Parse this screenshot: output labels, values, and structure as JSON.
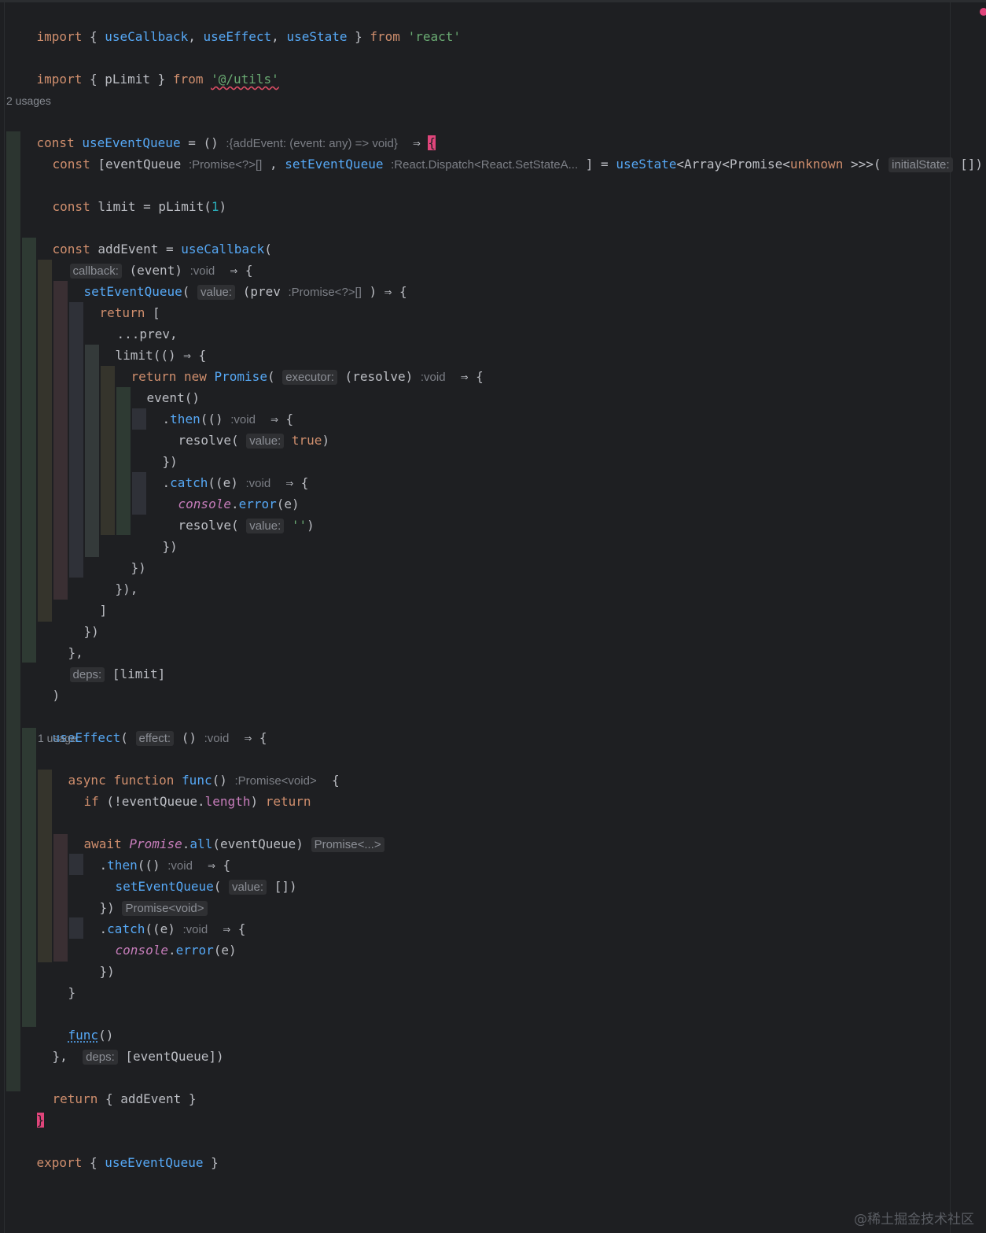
{
  "editor": {
    "usage_counts": {
      "use_event_queue": "2 usages",
      "func": "1 usage"
    },
    "watermark": "@稀土掘金技术社区",
    "colors": {
      "background": "#1e1f22",
      "keyword": "#cf8e6d",
      "function": "#56a8f5",
      "string": "#6aab73",
      "number": "#2aacb8",
      "italic_builtin": "#c77dbb",
      "error_marker": "#e0457b"
    }
  },
  "code": {
    "l1": {
      "kw_import": "import",
      "p1": " { ",
      "f1": "useCallback",
      "p2": ", ",
      "f2": "useEffect",
      "p3": ", ",
      "f3": "useState",
      "p4": " } ",
      "kw_from": "from",
      "sp": " ",
      "str": "'react'"
    },
    "l2": {
      "kw_import": "import",
      "p1": " { pLimit } ",
      "kw_from": "from",
      "sp": " ",
      "str": "'@/utils'"
    },
    "l3": {
      "kw": "const",
      "sp": " ",
      "fn": "useEventQueue",
      "p1": " = () ",
      "hint": ":{addEvent: (event: any) => void}",
      "p2": "  ⇒ ",
      "brace": "{"
    },
    "l4": {
      "kw": "const",
      "p1": " [eventQueue ",
      "h1": ":Promise<?>[]",
      "p2": " , ",
      "fn1": "setEventQueue",
      "sp": " ",
      "h2": ":React.Dispatch<React.SetStateA...",
      "p3": " ] = ",
      "fn2": "useState",
      "p4": "<Array<Promise<",
      "kw2": "unknown",
      "p5": " >>>( ",
      "ph": "initialState:",
      "p6": " [])"
    },
    "l5": {
      "kw": "const",
      "p1": " limit = pLimit(",
      "num": "1",
      "p2": ")"
    },
    "l6": {
      "kw": "const",
      "p1": " addEvent = ",
      "fn": "useCallback",
      "p2": "("
    },
    "l7": {
      "ph": "callback:",
      "p1": " (event) ",
      "h": ":void",
      "p2": "  ⇒ {"
    },
    "l8": {
      "fn": "setEventQueue",
      "p1": "( ",
      "ph": "value:",
      "p2": " (prev ",
      "h": ":Promise<?>[]",
      "p3": " ) ⇒ {"
    },
    "l9": {
      "kw": "return",
      "p1": " ["
    },
    "l10": {
      "p1": "...prev,"
    },
    "l11": {
      "p1": "limit(() ⇒ {"
    },
    "l12": {
      "kw1": "return",
      "sp": " ",
      "kw2": "new",
      "sp2": " ",
      "fn": "Promise",
      "p1": "( ",
      "ph": "executor:",
      "p2": " (resolve) ",
      "h": ":void",
      "p3": "  ⇒ {"
    },
    "l13": {
      "p1": "event()"
    },
    "l14": {
      "p1": ".",
      "fn": "then",
      "p2": "(() ",
      "h": ":void",
      "p3": "  ⇒ {"
    },
    "l15": {
      "p1": "resolve( ",
      "ph": "value:",
      "sp": " ",
      "kw": "true",
      "p2": ")"
    },
    "l16": {
      "p1": "})"
    },
    "l17": {
      "p1": ".",
      "fn": "catch",
      "p2": "((e) ",
      "h": ":void",
      "p3": "  ⇒ {"
    },
    "l18": {
      "it": "console",
      "p1": ".",
      "fn": "error",
      "p2": "(e)"
    },
    "l19": {
      "p1": "resolve( ",
      "ph": "value:",
      "sp": " ",
      "str": "''",
      "p2": ")"
    },
    "l20": {
      "p1": "})"
    },
    "l21": {
      "p1": "})"
    },
    "l22": {
      "p1": "}),"
    },
    "l23": {
      "p1": "]"
    },
    "l24": {
      "p1": "})"
    },
    "l25": {
      "p1": "},"
    },
    "l26": {
      "ph": "deps:",
      "p1": " [limit]"
    },
    "l27": {
      "p1": ")"
    },
    "l28": {
      "fn": "useEffect",
      "p1": "( ",
      "ph": "effect:",
      "p2": " () ",
      "h": ":void",
      "p3": "  ⇒ {"
    },
    "l29": {
      "kw1": "async",
      "sp": " ",
      "kw2": "function",
      "sp2": " ",
      "fn": "func",
      "p1": "() ",
      "h": ":Promise<void>",
      "p2": "  {"
    },
    "l30": {
      "kw1": "if",
      "p1": " (!eventQueue.",
      "pr": "length",
      "p2": ") ",
      "kw2": "return"
    },
    "l31": {
      "kw": "await",
      "sp": " ",
      "it": "Promise",
      "p1": ".",
      "fn": "all",
      "p2": "(eventQueue) ",
      "ph": "Promise<...>"
    },
    "l32": {
      "p1": ".",
      "fn": "then",
      "p2": "(() ",
      "h": ":void",
      "p3": "  ⇒ {"
    },
    "l33": {
      "fn": "setEventQueue",
      "p1": "( ",
      "ph": "value:",
      "p2": " [])"
    },
    "l34": {
      "p1": "}) ",
      "ph": "Promise<void>"
    },
    "l35": {
      "p1": ".",
      "fn": "catch",
      "p2": "((e) ",
      "h": ":void",
      "p3": "  ⇒ {"
    },
    "l36": {
      "it": "console",
      "p1": ".",
      "fn": "error",
      "p2": "(e)"
    },
    "l37": {
      "p1": "})"
    },
    "l38": {
      "p1": "}"
    },
    "l39": {
      "fn": "func",
      "p1": "()"
    },
    "l40": {
      "p1": "},  ",
      "ph": "deps:",
      "p2": " [eventQueue])"
    },
    "l41": {
      "kw": "return",
      "p1": " { addEvent }"
    },
    "l42": {
      "brace": "}"
    },
    "l43": {
      "kw": "export",
      "p1": " { ",
      "fn": "useEventQueue",
      "p2": " }"
    }
  }
}
